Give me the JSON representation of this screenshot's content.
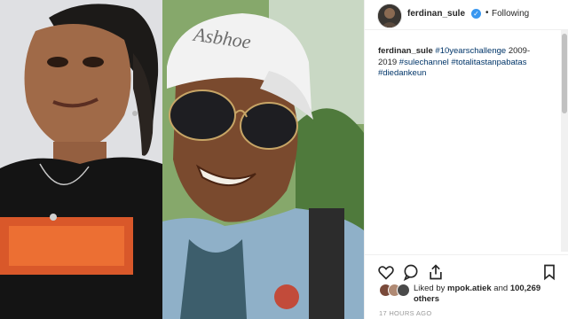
{
  "post": {
    "username": "ferdinan_sule",
    "verified_mark": "✓",
    "follow_dot": "•",
    "follow_status": "Following",
    "caption_user": "ferdinan_sule",
    "caption_text": " ",
    "tags": [
      "#10yearschallenge",
      " 2009-2019 ",
      "#sulechannel",
      " ",
      "#totalitastanpabatas",
      " ",
      "#diedankeun"
    ],
    "cap_brand": "Asbhoe"
  },
  "likes": {
    "prefix": "Liked by ",
    "user": "mpok.atiek",
    "mid": " and ",
    "count": "100,269 others"
  },
  "timestamp": "17 HOURS AGO",
  "icons": [
    "heart-icon",
    "comment-icon",
    "share-icon",
    "bookmark-icon"
  ],
  "colors": {
    "verified": "#3897f0",
    "tag": "#003569",
    "text": "#262626",
    "muted": "#999999"
  }
}
